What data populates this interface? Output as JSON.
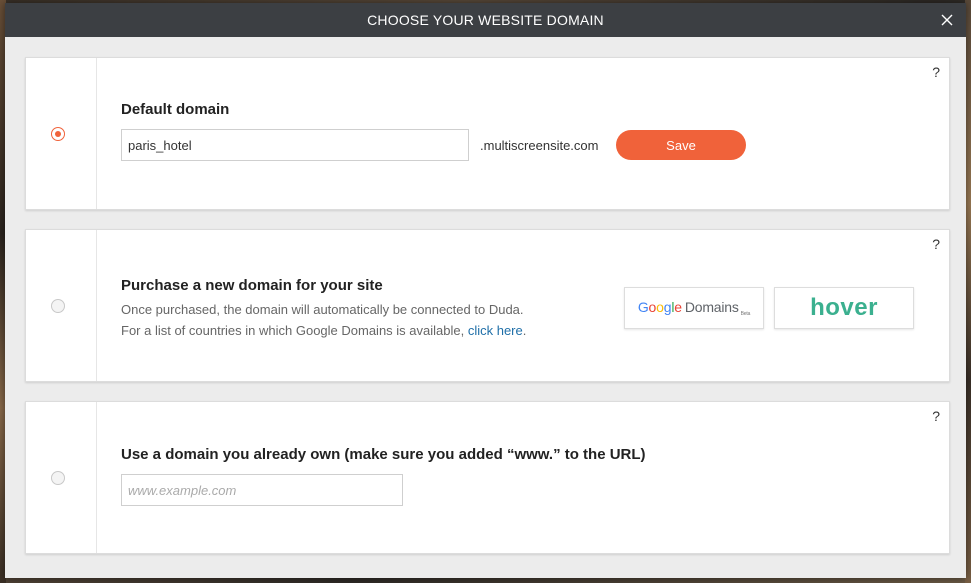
{
  "modal": {
    "title": "CHOOSE YOUR WEBSITE DOMAIN",
    "close_icon": "close-icon"
  },
  "default_domain": {
    "selected": true,
    "help": "?",
    "heading": "Default domain",
    "input_value": "paris_hotel",
    "suffix": ".multiscreensite.com",
    "save_label": "Save"
  },
  "purchase_domain": {
    "selected": false,
    "help": "?",
    "heading": "Purchase a new domain for your site",
    "line1": "Once purchased, the domain will automatically be connected to Duda.",
    "line2": "For a list of countries in which Google Domains is available, ",
    "link": "click here",
    "line2_end": ".",
    "providers": {
      "google": {
        "g": "G",
        "o1": "o",
        "o2": "o",
        "g2": "g",
        "l": "l",
        "e": "e",
        "domains": "Domains",
        "beta": "Beta"
      },
      "hover": "hover"
    }
  },
  "own_domain": {
    "selected": false,
    "help": "?",
    "heading": "Use a domain you already own (make sure you added “www.” to the URL)",
    "placeholder": "www.example.com",
    "input_value": ""
  },
  "colors": {
    "accent": "#f0623a",
    "header_bg": "#3c3f43",
    "link": "#1f6fa8",
    "hover_brand": "#3bb08f"
  }
}
